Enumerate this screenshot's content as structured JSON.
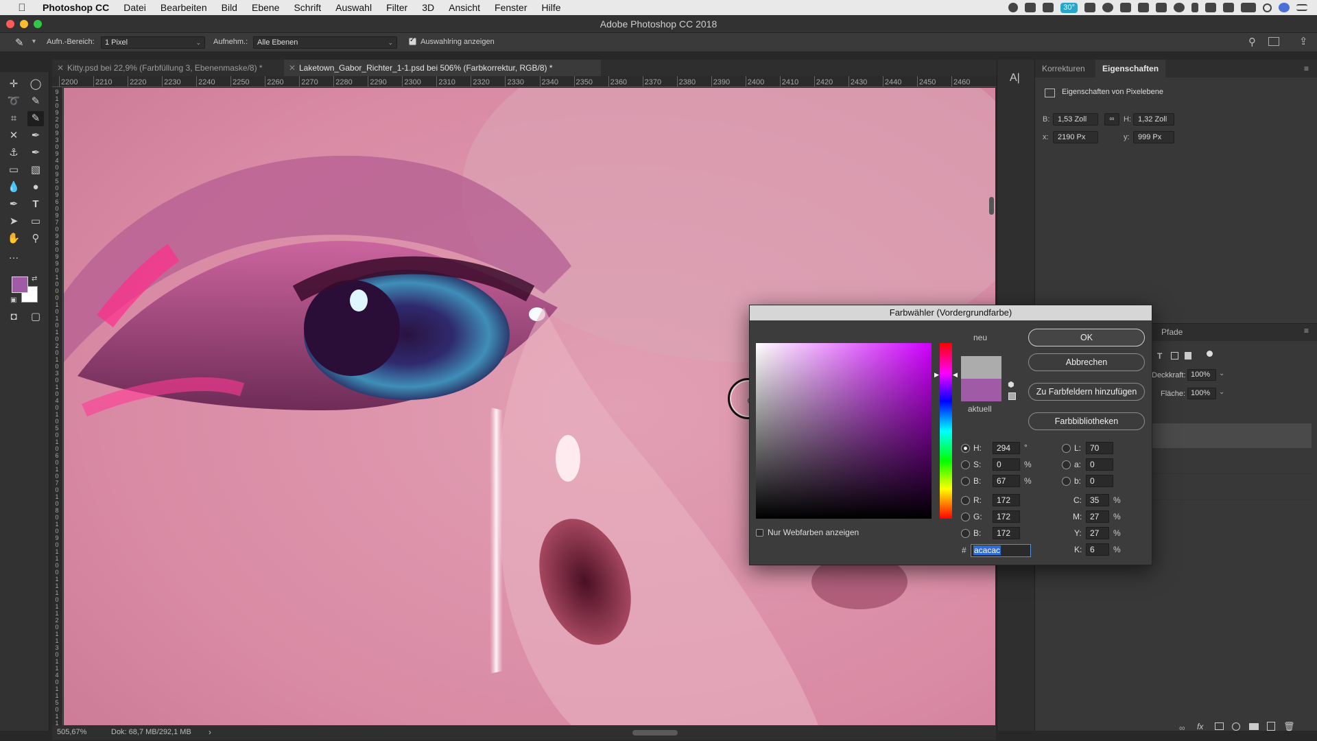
{
  "menubar": {
    "app": "Photoshop CC",
    "items": [
      "Datei",
      "Bearbeiten",
      "Bild",
      "Ebene",
      "Schrift",
      "Auswahl",
      "Filter",
      "3D",
      "Ansicht",
      "Fenster",
      "Hilfe"
    ],
    "battery_badge": "30°"
  },
  "window": {
    "title": "Adobe Photoshop CC 2018"
  },
  "options": {
    "sample_size_label": "Aufn.-Bereich:",
    "sample_size_value": "1 Pixel",
    "sample_label": "Aufnehm.:",
    "sample_value": "Alle Ebenen",
    "show_ring_label": "Auswahlring anzeigen"
  },
  "tabs": [
    {
      "label": "Kitty.psd bei 22,9% (Farbfüllung 3, Ebenenmaske/8) *"
    },
    {
      "label": "Laketown_Gabor_Richter_1-1.psd bei 506% (Farbkorrektur, RGB/8) *"
    }
  ],
  "ruler": {
    "top": [
      "2200",
      "2210",
      "2220",
      "2230",
      "2240",
      "2250",
      "2260",
      "2270",
      "2280",
      "2290",
      "2300",
      "2310",
      "2320",
      "2330",
      "2340",
      "2350",
      "2360",
      "2370",
      "2380",
      "2390",
      "2400",
      "2410",
      "2420",
      "2430",
      "2440",
      "2450",
      "2460"
    ],
    "left": [
      "9",
      "1",
      "0",
      "9",
      "2",
      "0",
      "9",
      "3",
      "0",
      "9",
      "4",
      "0",
      "9",
      "5",
      "0",
      "9",
      "6",
      "0",
      "9",
      "7",
      "0",
      "9",
      "8",
      "0",
      "9",
      "9",
      "0",
      "1",
      "0",
      "0",
      "0",
      "1",
      "0",
      "1",
      "0",
      "1",
      "0",
      "2",
      "0",
      "1",
      "0",
      "3",
      "0",
      "1",
      "0",
      "4",
      "0",
      "1",
      "0",
      "5",
      "0",
      "1",
      "0",
      "6",
      "0",
      "1",
      "0",
      "7",
      "0",
      "1",
      "0",
      "8",
      "0",
      "1",
      "0",
      "9",
      "0",
      "1",
      "1",
      "0",
      "0",
      "1",
      "1",
      "1",
      "0",
      "1",
      "1",
      "2",
      "0",
      "1",
      "1",
      "3",
      "0",
      "1",
      "1",
      "4",
      "0",
      "1",
      "1",
      "5",
      "0",
      "1",
      "1",
      "6"
    ]
  },
  "status": {
    "zoom": "505,67%",
    "doc": "Dok: 68,7 MB/292,1 MB"
  },
  "panel": {
    "tab_corrections": "Korrekturen",
    "tab_properties": "Eigenschaften",
    "section_title": "Eigenschaften von Pixelebene",
    "w_label": "B:",
    "w_value": "1,53 Zoll",
    "h_label": "H:",
    "h_value": "1,32 Zoll",
    "x_label": "x:",
    "x_value": "2190 Px",
    "y_label": "y:",
    "y_value": "999 Px",
    "paths_tab": "Pfade",
    "opacity_label": "Deckkraft:",
    "opacity_value": "100%",
    "fill_label": "Fläche:",
    "fill_value": "100%"
  },
  "dialog": {
    "title": "Farbwähler (Vordergrundfarbe)",
    "new_label": "neu",
    "current_label": "aktuell",
    "new_color": "#acacac",
    "current_color": "#9f5ba6",
    "hue_color": "#d000ff",
    "ok": "OK",
    "cancel": "Abbrechen",
    "add_swatches": "Zu Farbfeldern hinzufügen",
    "libraries": "Farbbibliotheken",
    "web_only": "Nur Webfarben anzeigen",
    "fields": {
      "H": {
        "label": "H:",
        "value": "294",
        "unit": "°"
      },
      "S": {
        "label": "S:",
        "value": "0",
        "unit": "%"
      },
      "Bv": {
        "label": "B:",
        "value": "67",
        "unit": "%"
      },
      "R": {
        "label": "R:",
        "value": "172"
      },
      "G": {
        "label": "G:",
        "value": "172"
      },
      "Bl": {
        "label": "B:",
        "value": "172"
      },
      "L": {
        "label": "L:",
        "value": "70"
      },
      "a": {
        "label": "a:",
        "value": "0"
      },
      "b": {
        "label": "b:",
        "value": "0"
      },
      "C": {
        "label": "C:",
        "value": "35",
        "unit": "%"
      },
      "M": {
        "label": "M:",
        "value": "27",
        "unit": "%"
      },
      "Y": {
        "label": "Y:",
        "value": "27",
        "unit": "%"
      },
      "K": {
        "label": "K:",
        "value": "6",
        "unit": "%"
      }
    },
    "hash": "#",
    "hex": "acacac"
  }
}
